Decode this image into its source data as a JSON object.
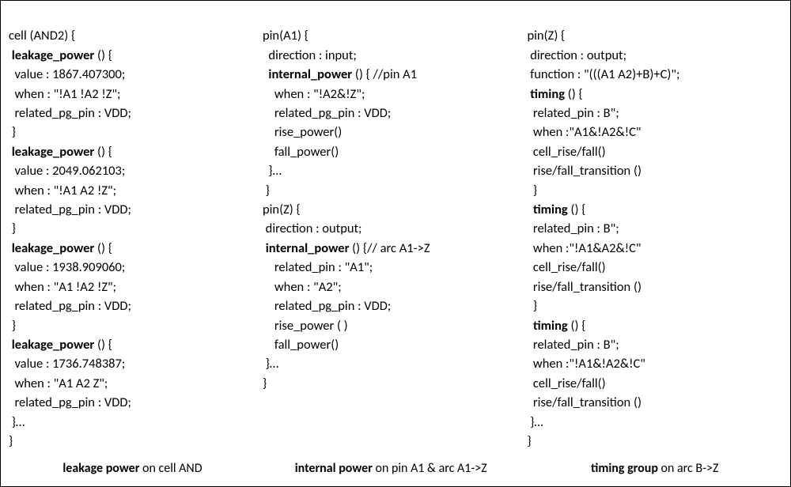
{
  "col1": {
    "l0": "cell (AND2) {",
    "l1": " leakage_power",
    "l1b": " () {",
    "l2": "  value : 1867.407300;",
    "l3": "  when : \"!A1 !A2 !Z\";",
    "l4": "  related_pg_pin : VDD;",
    "l5": " }",
    "l6": " leakage_power",
    "l6b": " () {",
    "l7": "  value : 2049.062103;",
    "l8": "  when : \"!A1 A2 !Z\";",
    "l9": "  related_pg_pin : VDD;",
    "l10": " }",
    "l11": " leakage_power",
    "l11b": " () {",
    "l12": "  value : 1938.909060;",
    "l13": "  when : \"A1 !A2 !Z\";",
    "l14": "  related_pg_pin : VDD;",
    "l15": " }",
    "l16": " leakage_power",
    "l16b": " () {",
    "l17": "  value : 1736.748387;",
    "l18": "  when : \"A1 A2 Z\";",
    "l19": "  related_pg_pin : VDD;",
    "l20": " }…",
    "l21": "}",
    "caption_bold": "leakage power",
    "caption_rest": " on cell AND"
  },
  "col2": {
    "l0": "pin(A1) {",
    "l1": "  direction : input;",
    "l2a": "  ",
    "l2b": "internal_power",
    "l2c": " () { //pin A1",
    "l3": "    when : \"!A2&!Z\";",
    "l4": "    related_pg_pin : VDD;",
    "l5": "    rise_power()",
    "l6": "    fall_power()",
    "l7": "  }…",
    "l8": " }",
    "l9": "pin(Z) {",
    "l10": " direction : output;",
    "l11a": " ",
    "l11b": "internal_power",
    "l11c": " () {// arc A1->Z",
    "l12": "    related_pin : \"A1\";",
    "l13": "    when : \"A2\";",
    "l14": "    related_pg_pin : VDD;",
    "l15": "    rise_power ( )",
    "l16": "    fall_power()",
    "l17": " }…",
    "l18": "}",
    "caption_bold": "internal power",
    "caption_rest": " on pin A1 & arc A1->Z"
  },
  "col3": {
    "l0": "pin(Z) {",
    "l1": " direction : output;",
    "l2": " function : \"(((A1 A2)+B)+C)\";",
    "l3a": " ",
    "l3b": "timing",
    "l3c": " () {",
    "l4": "  related_pin : B\";",
    "l5": "  when :\"A1&!A2&!C\"",
    "l6": "  cell_rise/fall()",
    "l7": "  rise/fall_transition ()",
    "l8": "  }",
    "l9a": "  ",
    "l9b": "timing",
    "l9c": " () {",
    "l10": "  related_pin : B\";",
    "l11": "  when :\"!A1&A2&!C\"",
    "l12": "  cell_rise/fall()",
    "l13": "  rise/fall_transition ()",
    "l14": "  }",
    "l15a": "  ",
    "l15b": "timing",
    "l15c": " () {",
    "l16": "  related_pin : B\";",
    "l17": "  when :\"!A1&!A2&!C\"",
    "l18": "  cell_rise/fall()",
    "l19": "  rise/fall_transition ()",
    "l20": " }…",
    "l21": "}",
    "caption_bold": "timing group",
    "caption_rest": " on arc B->Z"
  }
}
